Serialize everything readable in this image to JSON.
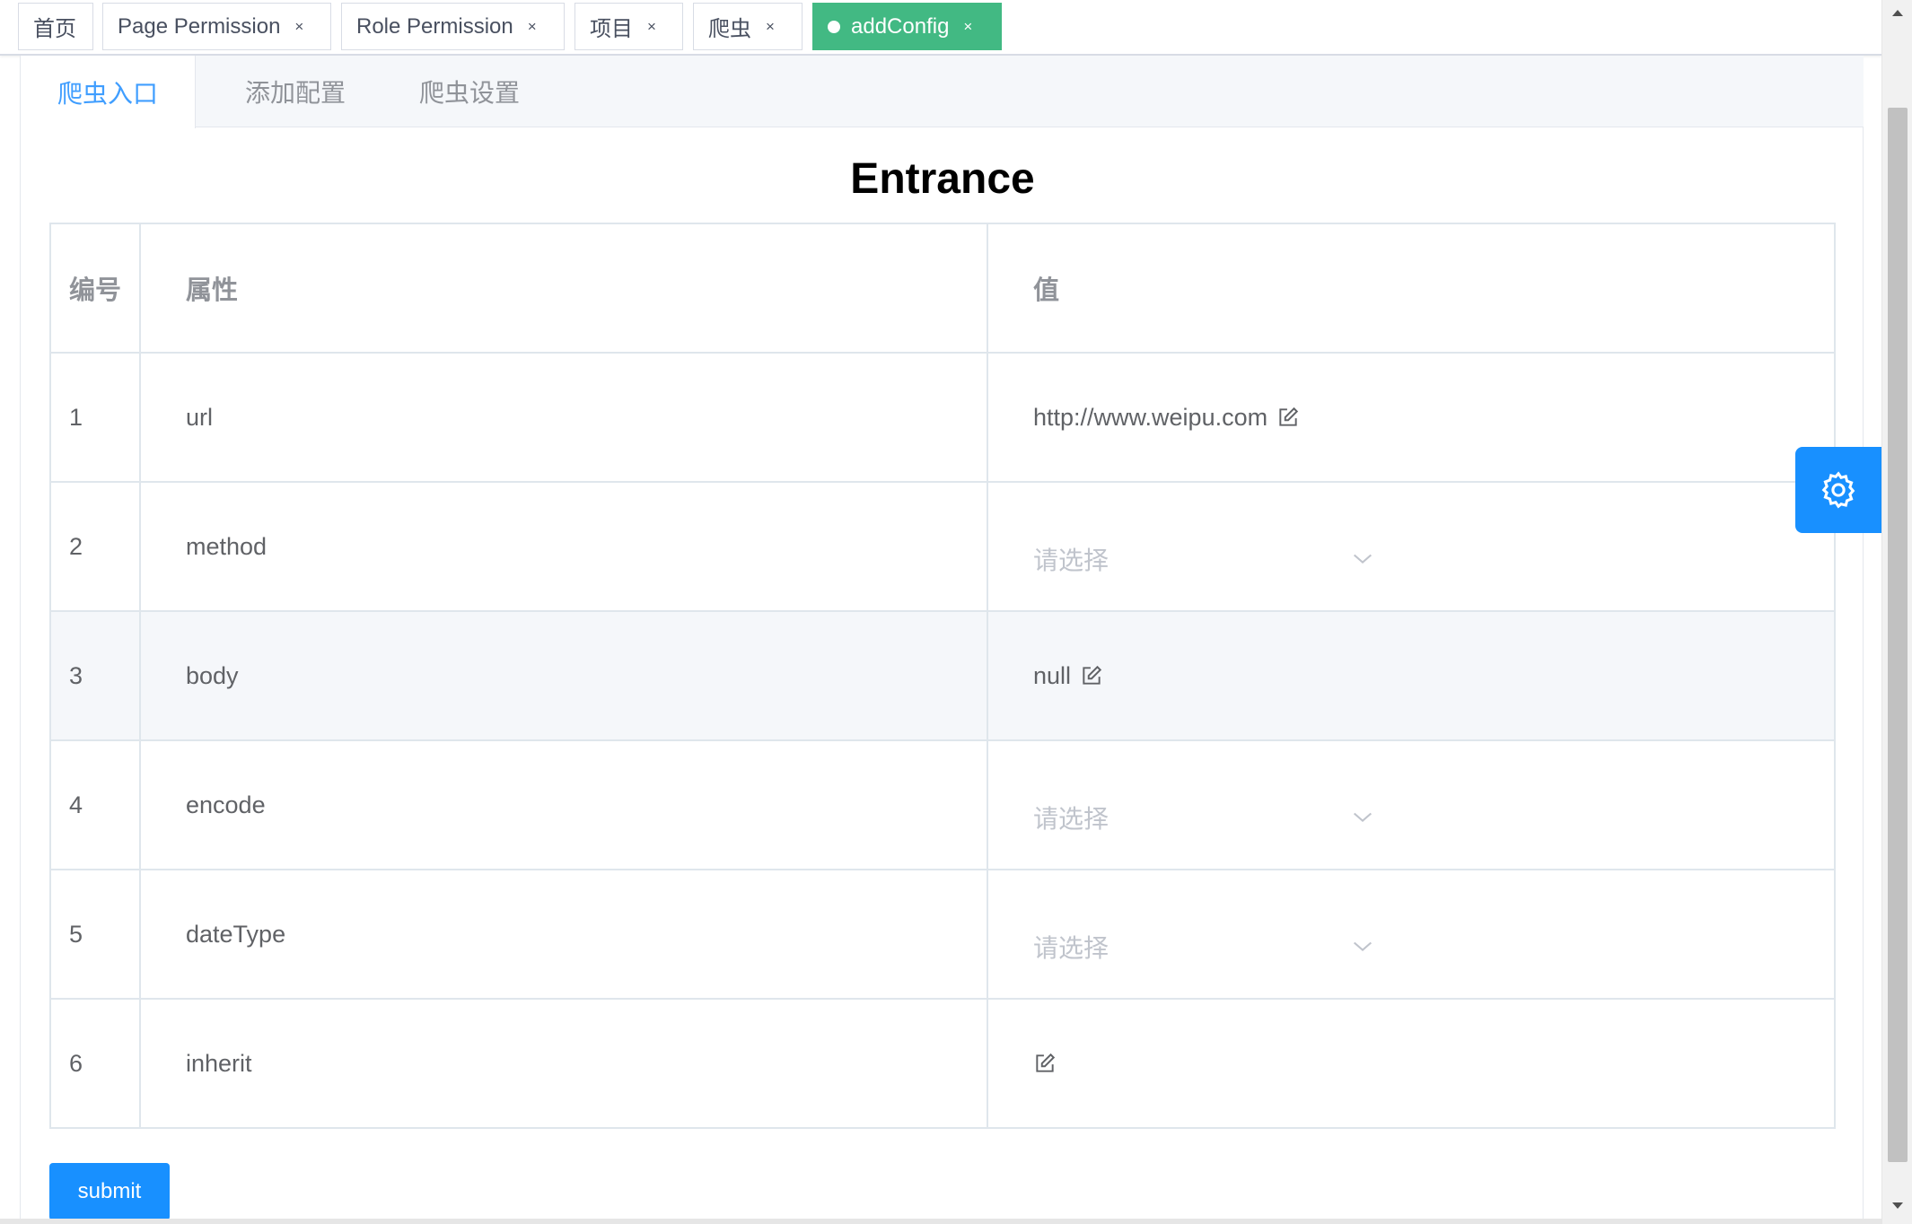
{
  "tags": [
    {
      "label": "首页",
      "closable": false
    },
    {
      "label": "Page Permission",
      "closable": true
    },
    {
      "label": "Role Permission",
      "closable": true
    },
    {
      "label": "项目",
      "closable": true
    },
    {
      "label": "爬虫",
      "closable": true
    },
    {
      "label": "addConfig",
      "closable": true,
      "active": true
    }
  ],
  "close_glyph": "×",
  "tabs": [
    {
      "label": "爬虫入口",
      "active": true
    },
    {
      "label": "添加配置",
      "active": false
    },
    {
      "label": "爬虫设置",
      "active": false
    }
  ],
  "title": "Entrance",
  "table": {
    "headers": [
      "编号",
      "属性",
      "值"
    ],
    "rows": [
      {
        "no": "1",
        "prop": "url",
        "value": "http://www.weipu.com",
        "kind": "edit"
      },
      {
        "no": "2",
        "prop": "method",
        "placeholder": "请选择",
        "kind": "select"
      },
      {
        "no": "3",
        "prop": "body",
        "value": "null",
        "kind": "edit"
      },
      {
        "no": "4",
        "prop": "encode",
        "placeholder": "请选择",
        "kind": "select"
      },
      {
        "no": "5",
        "prop": "dateType",
        "placeholder": "请选择",
        "kind": "select"
      },
      {
        "no": "6",
        "prop": "inherit",
        "value": "",
        "kind": "edit"
      }
    ]
  },
  "submit_label": "submit",
  "colors": {
    "accent": "#1890ff",
    "active_tag": "#42b983",
    "tab_active": "#409eff"
  },
  "icons": [
    "edit-icon",
    "chevron-down-icon",
    "gear-icon",
    "close-icon"
  ]
}
